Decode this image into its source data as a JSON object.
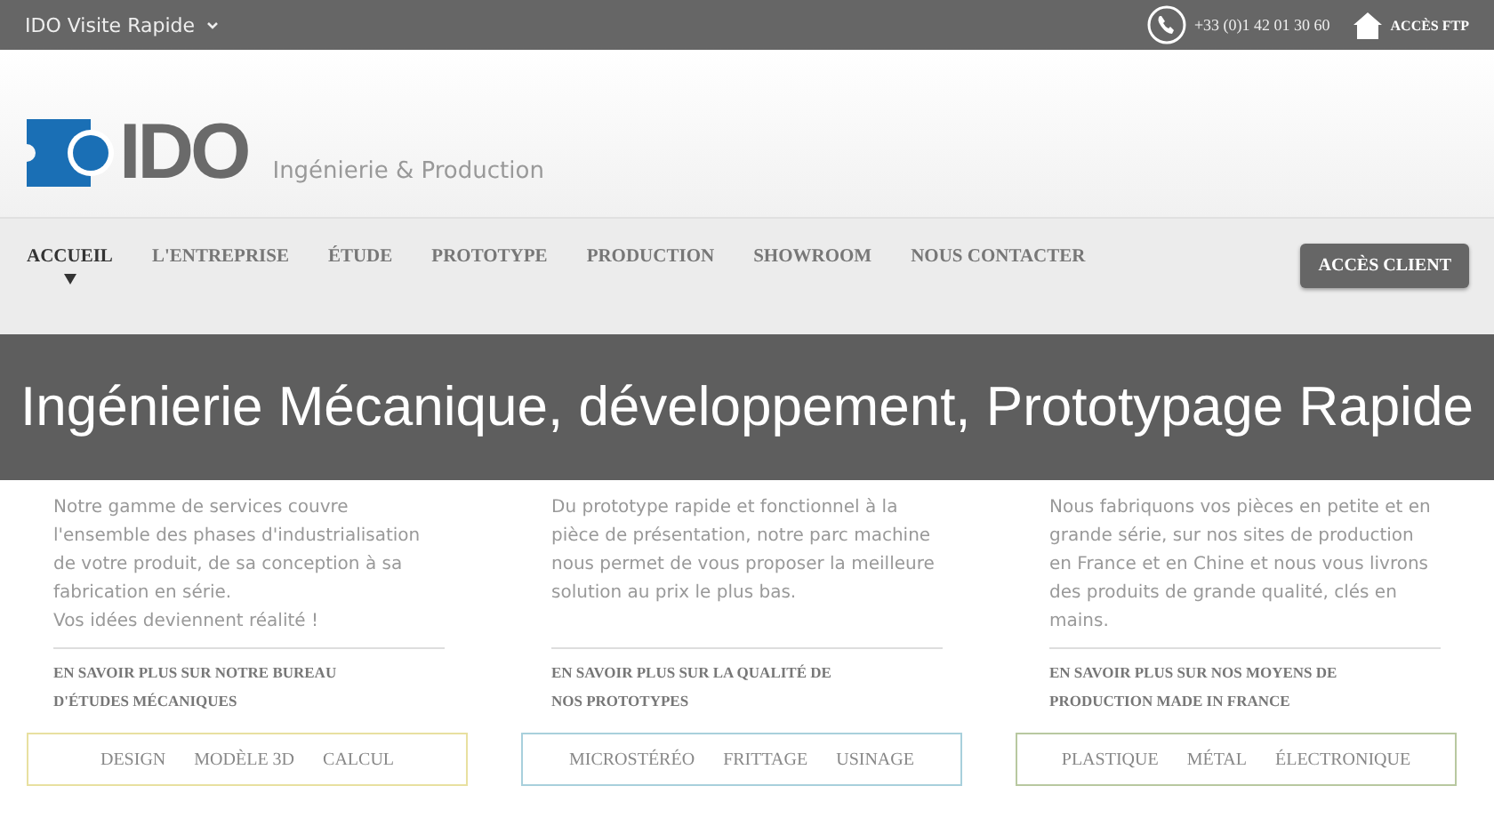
{
  "top_bar": {
    "site_menu": "IDO Visite Rapide",
    "phone": "+33 (0)1 42 01 30 60",
    "ftp_link": "ACCÈS FTP"
  },
  "header": {
    "logo_text": "IDO",
    "tagline": "Ingénierie & Production"
  },
  "nav": {
    "items": [
      {
        "label": "ACCUEIL",
        "selected": true
      },
      {
        "label": "L'ENTREPRISE",
        "selected": false
      },
      {
        "label": "ÉTUDE",
        "selected": false
      },
      {
        "label": "PROTOTYPE",
        "selected": false
      },
      {
        "label": "PRODUCTION",
        "selected": false
      },
      {
        "label": "SHOWROOM",
        "selected": false
      },
      {
        "label": "NOUS CONTACTER",
        "selected": false
      }
    ],
    "client_button": "ACCÈS CLIENT"
  },
  "banner": {
    "title": "Ingénierie Mécanique, développement, Prototypage Rapide"
  },
  "columns": [
    {
      "paragraphs": [
        "Notre gamme de services couvre l'ensemble des phases d'industrialisation de votre produit, de sa conception à sa fabrication en série.",
        "Vos idées deviennent réalité !"
      ],
      "link_lines": [
        "EN SAVOIR PLUS SUR NOTRE BUREAU",
        "D'ÉTUDES MÉCANIQUES"
      ],
      "color": "#e8e0a0",
      "tags": [
        "DESIGN",
        "MODÈLE 3D",
        "CALCUL"
      ]
    },
    {
      "paragraphs": [
        "Du prototype rapide et fonctionnel à la pièce de présentation, notre parc machine nous permet de vous proposer la meilleure solution au prix le plus bas."
      ],
      "link_lines": [
        "EN SAVOIR PLUS SUR LA QUALITÉ DE",
        "NOS PROTOTYPES"
      ],
      "color": "#a8d0dc",
      "tags": [
        "MICROSTÉRÉO",
        "FRITTAGE",
        "USINAGE"
      ]
    },
    {
      "paragraphs": [
        "Nous fabriquons vos pièces en petite et en grande série, sur nos sites de production en France et en Chine et nous vous livrons des produits de grande qualité, clés en mains."
      ],
      "link_lines": [
        "EN SAVOIR PLUS SUR NOS MOYENS DE",
        "PRODUCTION MADE IN FRANCE"
      ],
      "color": "#b8c8a0",
      "tags": [
        "PLASTIQUE",
        "MÉTAL",
        "ÉLECTRONIQUE"
      ]
    }
  ]
}
